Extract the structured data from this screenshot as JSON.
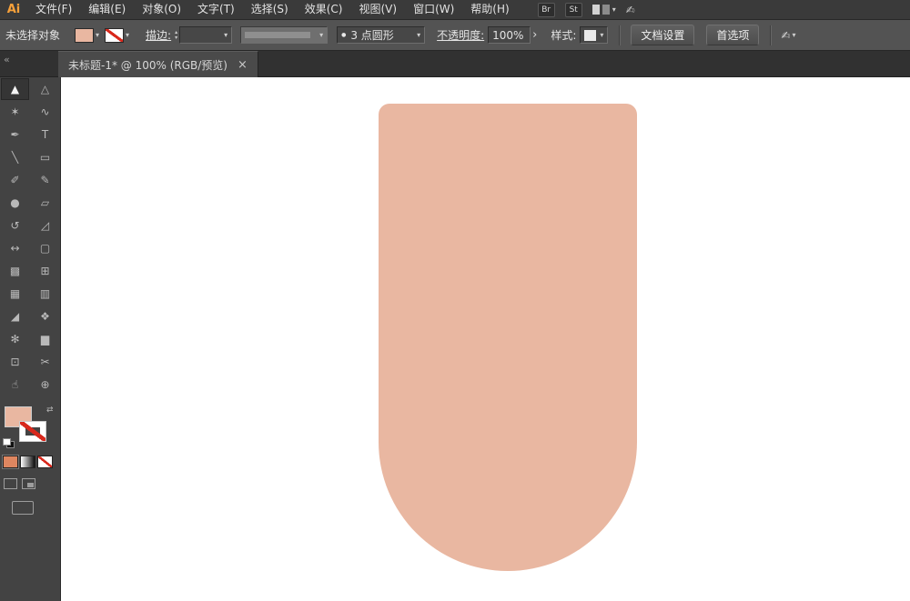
{
  "app_bar": {
    "logo": "Ai",
    "menu_items": [
      {
        "id": "file",
        "label": "文件(F)"
      },
      {
        "id": "edit",
        "label": "编辑(E)"
      },
      {
        "id": "object",
        "label": "对象(O)"
      },
      {
        "id": "type",
        "label": "文字(T)"
      },
      {
        "id": "select",
        "label": "选择(S)"
      },
      {
        "id": "effect",
        "label": "效果(C)"
      },
      {
        "id": "view",
        "label": "视图(V)"
      },
      {
        "id": "window",
        "label": "窗口(W)"
      },
      {
        "id": "help",
        "label": "帮助(H)"
      }
    ],
    "br_badge": "Br",
    "st_badge": "St"
  },
  "control_bar": {
    "status": "未选择对象",
    "stroke_label": "描边:",
    "brush_name": "3 点圆形",
    "opacity_label": "不透明度:",
    "opacity_value": "100%",
    "style_label": "样式:",
    "document_setup_button": "文档设置",
    "preferences_button": "首选项"
  },
  "document_tab": {
    "title": "未标题-1* @ 100% (RGB/预览)",
    "close_glyph": "×"
  },
  "icons": {
    "caret_down": "▾",
    "stepper_up": "▴",
    "stepper_down": "▾",
    "collapse": "«",
    "swap": "⇄",
    "brush_dot": "●",
    "expander": "›",
    "cs_live": "✍"
  },
  "tools": [
    {
      "name": "selection-tool",
      "glyph": "▲",
      "active": true
    },
    {
      "name": "direct-selection-tool",
      "glyph": "△",
      "active": false
    },
    {
      "name": "magic-wand-tool",
      "glyph": "✶",
      "active": false
    },
    {
      "name": "lasso-tool",
      "glyph": "∿",
      "active": false
    },
    {
      "name": "pen-tool",
      "glyph": "✒",
      "active": false
    },
    {
      "name": "type-tool",
      "glyph": "T",
      "active": false
    },
    {
      "name": "line-segment-tool",
      "glyph": "╲",
      "active": false
    },
    {
      "name": "rectangle-tool",
      "glyph": "▭",
      "active": false
    },
    {
      "name": "paintbrush-tool",
      "glyph": "✐",
      "active": false
    },
    {
      "name": "pencil-tool",
      "glyph": "✎",
      "active": false
    },
    {
      "name": "blob-brush-tool",
      "glyph": "●",
      "active": false
    },
    {
      "name": "eraser-tool",
      "glyph": "▱",
      "active": false
    },
    {
      "name": "rotate-tool",
      "glyph": "↺",
      "active": false
    },
    {
      "name": "scale-tool",
      "glyph": "◿",
      "active": false
    },
    {
      "name": "width-tool",
      "glyph": "↔",
      "active": false
    },
    {
      "name": "free-transform-tool",
      "glyph": "▢",
      "active": false
    },
    {
      "name": "shape-builder-tool",
      "glyph": "▩",
      "active": false
    },
    {
      "name": "perspective-grid-tool",
      "glyph": "⊞",
      "active": false
    },
    {
      "name": "mesh-tool",
      "glyph": "▦",
      "active": false
    },
    {
      "name": "gradient-tool",
      "glyph": "▥",
      "active": false
    },
    {
      "name": "eyedropper-tool",
      "glyph": "◢",
      "active": false
    },
    {
      "name": "blend-tool",
      "glyph": "❖",
      "active": false
    },
    {
      "name": "symbol-sprayer-tool",
      "glyph": "✻",
      "active": false
    },
    {
      "name": "column-graph-tool",
      "glyph": "▆",
      "active": false
    },
    {
      "name": "artboard-tool",
      "glyph": "⊡",
      "active": false
    },
    {
      "name": "slice-tool",
      "glyph": "✂",
      "active": false
    },
    {
      "name": "hand-tool",
      "glyph": "☝",
      "active": false
    },
    {
      "name": "zoom-tool",
      "glyph": "⊕",
      "active": false
    }
  ],
  "swatch_panel": {
    "fill_color": "#e9b7a1",
    "stroke": "none",
    "none_slash_color": "#d8281c",
    "color_button_color": "#de8660"
  },
  "canvas": {
    "background": "#ffffff",
    "shape_fill": "#e9b7a1"
  }
}
